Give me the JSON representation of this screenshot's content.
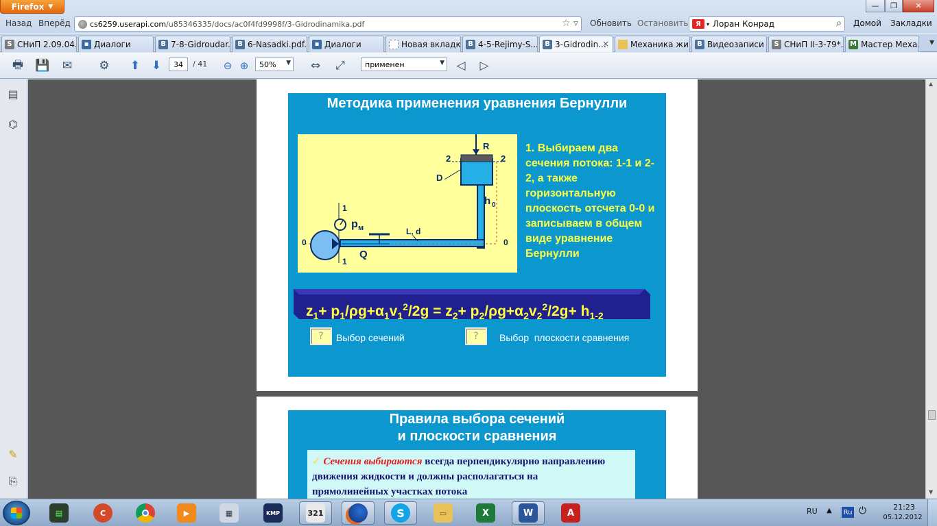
{
  "browser": {
    "menu_label": "Firefox",
    "back_label": "Назад",
    "forward_label": "Вперёд",
    "url_host": "cs6259.userapi.com",
    "url_path": "/u85346335/docs/ac0f4fd9998f/3-Gidrodinamika.pdf",
    "refresh_label": "Обновить",
    "stop_label": "Остановить",
    "search_engine": "Я",
    "search_value": "Лоран Конрад",
    "home_label": "Домой",
    "bookmarks_label": "Закладки",
    "window_controls": {
      "minimize": "—",
      "maximize": "❐",
      "close": "✕"
    }
  },
  "tabs": [
    {
      "label": "СНиП 2.09.04...",
      "icon": "snip-icon"
    },
    {
      "label": "Диалоги",
      "icon": "dialog-icon"
    },
    {
      "label": "7-8-Gidroudar...",
      "icon": "vk-icon"
    },
    {
      "label": "6-Nasadki.pdf...",
      "icon": "vk-icon"
    },
    {
      "label": "Диалоги",
      "icon": "dialog-icon"
    },
    {
      "label": "Новая вкладка",
      "icon": "blank-icon"
    },
    {
      "label": "4-5-Rejimy-S...",
      "icon": "vk-icon"
    },
    {
      "label": "3-Gidrodin...",
      "icon": "vk-icon",
      "active": true,
      "close": "×"
    },
    {
      "label": "Механика жи...",
      "icon": "folder-icon"
    },
    {
      "label": "Видеозаписи ...",
      "icon": "vk-icon"
    },
    {
      "label": "СНиП II-3-79*...",
      "icon": "snip-icon"
    },
    {
      "label": "Мастер Меха...",
      "icon": "mm-icon"
    }
  ],
  "pdf_toolbar": {
    "page_current": "34",
    "page_total": "/ 41",
    "zoom": "50%",
    "find_value": "применен"
  },
  "slide1": {
    "title": "Методика применения уравнения Бернулли",
    "step_text": "1. Выбираем два сечения потока: 1-1 и 2-2, а также горизонтальную плоскость отсчета 0-0 и записываем в общем виде уравнение Бернулли",
    "diagram_labels": {
      "R": "R",
      "two_left": "2",
      "two_right": "2",
      "D": "D",
      "h": "h",
      "h_sub": "0",
      "one_top": "1",
      "one_bottom": "1",
      "p": "p",
      "p_sub": "м",
      "Ld": "L, d",
      "zero_left": "0",
      "zero_right": "0",
      "Q": "Q"
    },
    "equation": {
      "z1": "z",
      "z1_sub": "1",
      "plus1": "+ p",
      "p1_sub": "1",
      "div1": "/ρg+α",
      "a1_sub": "1",
      "v1": "v",
      "v1_sub": "1",
      "v1_sup": "2",
      "g1": "/2g = z",
      "z2_sub": "2",
      "plus2": "+ p",
      "p2_sub": "2",
      "div2": "/ρg+α",
      "a2_sub": "2",
      "v2": "v",
      "v2_sub": "2",
      "v2_sup": "2",
      "tail": "/2g+ h",
      "h_sub": "1-2"
    },
    "q_mark": "?",
    "btn1_label": "Выбор сечений",
    "btn2_label": "Выбор  плоскости сравнения"
  },
  "slide2": {
    "title_line1": "Правила выбора сечений",
    "title_line2": "и плоскости сравнения",
    "bullet": "✓",
    "red_text": "Сечения выбираются",
    "body_text": " всегда перпендикулярно направлению движения жидкости и должны располагаться на прямолинейных участках потока"
  },
  "taskbar": {
    "lang": "RU",
    "ru_badge": "Ru",
    "time": "21:23",
    "date": "05.12.2012",
    "items": [
      "task-manager-icon",
      "ccleaner-icon",
      "chrome-icon",
      "media-player-icon",
      "calculator-icon",
      "kmplayer-icon",
      "tv-321-icon",
      "firefox-icon",
      "skype-icon",
      "explorer-icon",
      "excel-icon",
      "word-icon",
      "autocad-icon"
    ]
  },
  "colors": {
    "slide_bg": "#0c98cf",
    "diagram_bg": "#ffff9c",
    "highlight_text": "#ffff3d",
    "viewer_bg": "#575757"
  }
}
